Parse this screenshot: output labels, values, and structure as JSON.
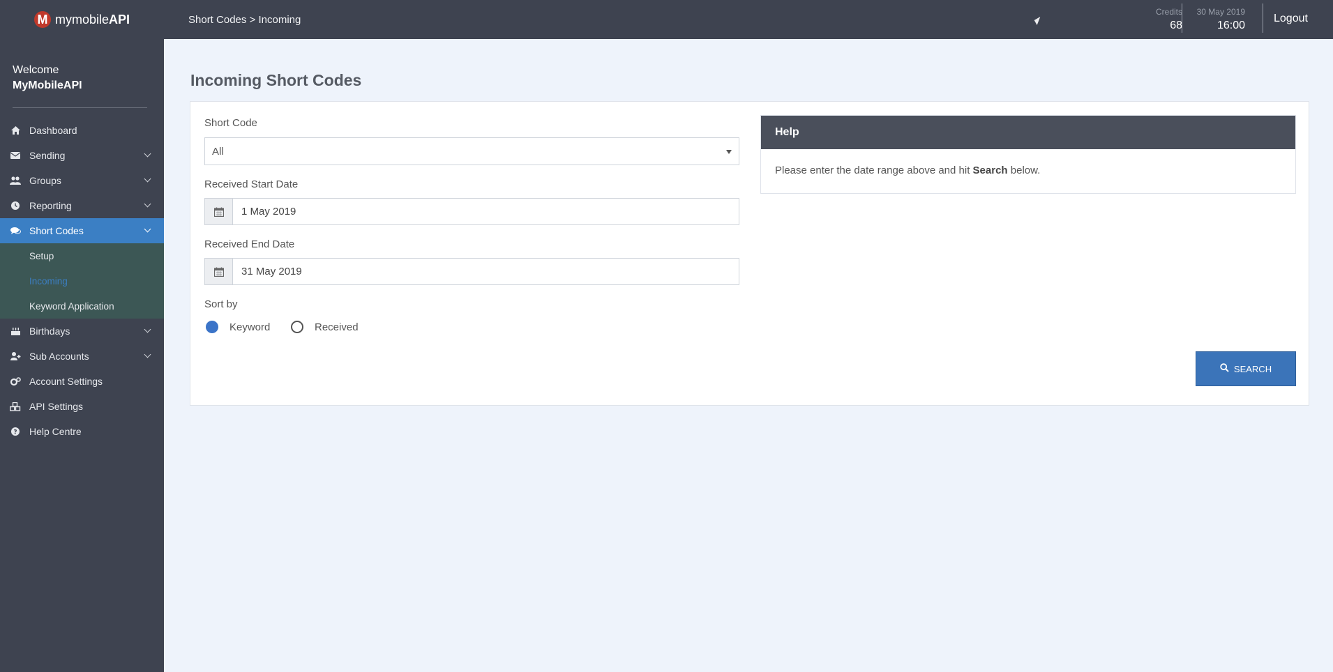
{
  "brand": {
    "mark": "M",
    "name_light": "mymobile",
    "name_bold": "API"
  },
  "welcome": {
    "greeting": "Welcome",
    "user": "MyMobileAPI"
  },
  "sidebar": {
    "items": [
      {
        "label": "Dashboard",
        "icon": "home-icon"
      },
      {
        "label": "Sending",
        "icon": "envelope-icon"
      },
      {
        "label": "Groups",
        "icon": "users-icon"
      },
      {
        "label": "Reporting",
        "icon": "clock-icon"
      },
      {
        "label": "Short Codes",
        "icon": "chat-icon"
      },
      {
        "label": "Birthdays",
        "icon": "cake-icon"
      },
      {
        "label": "Sub Accounts",
        "icon": "user-plus-icon"
      },
      {
        "label": "Account Settings",
        "icon": "cogs-icon"
      },
      {
        "label": "API Settings",
        "icon": "cubes-icon"
      },
      {
        "label": "Help Centre",
        "icon": "question-icon"
      }
    ],
    "short_codes_sub": [
      {
        "label": "Setup"
      },
      {
        "label": "Incoming"
      },
      {
        "label": "Keyword Application"
      }
    ]
  },
  "header": {
    "breadcrumb": "Short Codes > Incoming",
    "credits_label": "Credits",
    "credits_value": "68",
    "date": "30 May 2019",
    "time": "16:00",
    "logout": "Logout"
  },
  "page": {
    "title": "Incoming Short Codes",
    "short_code_label": "Short Code",
    "short_code_value": "All",
    "start_label": "Received Start Date",
    "start_value": "1 May 2019",
    "end_label": "Received End Date",
    "end_value": "31 May 2019",
    "sort_label": "Sort by",
    "sort_options": [
      "Keyword",
      "Received"
    ],
    "sort_selected": "Keyword",
    "search_label": "SEARCH"
  },
  "help": {
    "title": "Help",
    "text_before": "Please enter the date range above and hit ",
    "text_bold": "Search",
    "text_after": " below."
  },
  "colors": {
    "sidebar": "#3e4350",
    "accent": "#3b7fc4",
    "submenu": "#3c5755",
    "background": "#eef3fb"
  }
}
